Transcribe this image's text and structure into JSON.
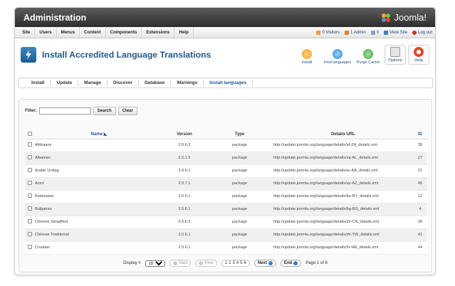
{
  "header": {
    "title": "Administration",
    "logo": "Joomla!"
  },
  "menu": {
    "items": [
      "Site",
      "Users",
      "Menus",
      "Content",
      "Components",
      "Extensions",
      "Help"
    ],
    "status": {
      "visitors": "0 Visitors",
      "admin": "1 Admin",
      "messages": "0",
      "view_site": "View Site",
      "logout": "Log out"
    }
  },
  "page": {
    "title": "Install Accredited Language Translations"
  },
  "toolbar": {
    "install": "Install",
    "find": "Find languages",
    "purge": "Purge Cache",
    "options": "Options",
    "help": "Help"
  },
  "tabs": [
    "Install",
    "Update",
    "Manage",
    "Discover",
    "Database",
    "Warnings",
    "Install languages"
  ],
  "active_tab": "Install languages",
  "filter": {
    "label": "Filter:",
    "value": "",
    "search": "Search",
    "clear": "Clear"
  },
  "table": {
    "headers": {
      "name": "Name",
      "version": "Version",
      "type": "Type",
      "url": "Details URL",
      "id": "ID"
    },
    "rows": [
      {
        "name": "Afrikaans",
        "version": "2.5.6.2",
        "type": "package",
        "url": "http://update.joomla.org/language/details/af-ZA_details.xml",
        "id": "35"
      },
      {
        "name": "Albanian",
        "version": "2.5.1.5",
        "type": "package",
        "url": "http://update.joomla.org/language/details/sq-AL_details.xml",
        "id": "27"
      },
      {
        "name": "Arabic Unitag",
        "version": "2.5.6.1",
        "type": "package",
        "url": "http://update.joomla.org/language/details/ar-AA_details.xml",
        "id": "21"
      },
      {
        "name": "Azeri",
        "version": "2.5.7.1",
        "type": "package",
        "url": "http://update.joomla.org/language/details/az-AZ_details.xml",
        "id": "45"
      },
      {
        "name": "Belarusian",
        "version": "2.5.6.1",
        "type": "package",
        "url": "http://update.joomla.org/language/details/be-BY_details.xml",
        "id": "12"
      },
      {
        "name": "Bulgarian",
        "version": "2.5.6.1",
        "type": "package",
        "url": "http://update.joomla.org/language/details/bg-BG_details.xml",
        "id": "4"
      },
      {
        "name": "Chinese Simplified",
        "version": "2.5.6.2",
        "type": "package",
        "url": "http://update.joomla.org/language/details/zh-CN_details.xml",
        "id": "36"
      },
      {
        "name": "Chinese Traditional",
        "version": "2.5.6.1",
        "type": "package",
        "url": "http://update.joomla.org/language/details/zh-TW_details.xml",
        "id": "41"
      },
      {
        "name": "Croatian",
        "version": "2.5.6.1",
        "type": "package",
        "url": "http://update.joomla.org/language/details/hr-HR_details.xml",
        "id": "44"
      }
    ]
  },
  "pagination": {
    "display_label": "Display #",
    "display_value": "10",
    "start": "Start",
    "prev": "Prev",
    "pages": [
      "1",
      "2",
      "3",
      "4",
      "5",
      "6"
    ],
    "next": "Next",
    "end": "End",
    "info": "Page 1 of 6"
  },
  "colors": {
    "title_blue": "#245887",
    "install": "#f0a020",
    "find": "#2a8ad0",
    "purge": "#3aa53a",
    "help": "#e04a2a"
  }
}
